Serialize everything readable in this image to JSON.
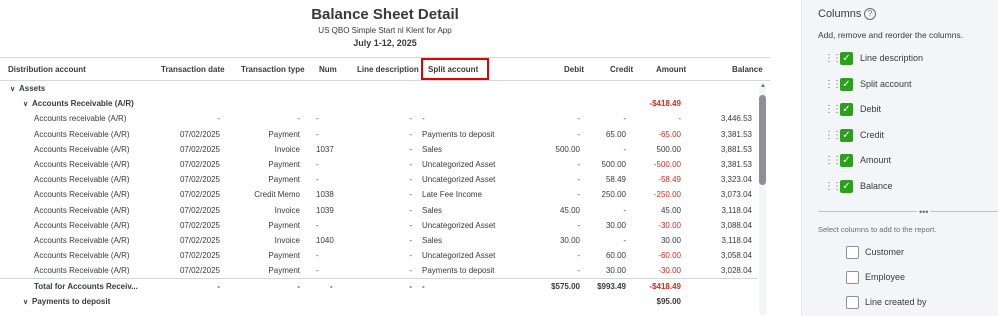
{
  "report": {
    "title": "Balance Sheet Detail",
    "company": "US QBO Simple Start nl Klent for App",
    "dates": "July 1-12, 2025",
    "columns": [
      "Distribution account",
      "Transaction date",
      "Transaction type",
      "Num",
      "Line description",
      "Split account",
      "Debit",
      "Credit",
      "Amount",
      "Balance"
    ],
    "section_assets": "Assets",
    "group_ar": "Accounts Receivable (A/R)",
    "group_ar_amount": "-$418.49",
    "rows": [
      {
        "acct": "Accounts receivable (A/R)",
        "date": "-",
        "type": "-",
        "num": "-",
        "desc": "-",
        "split": "-",
        "debit": "-",
        "credit": "-",
        "amount": "-",
        "balance": "3,446.53",
        "neg": false
      },
      {
        "acct": "Accounts Receivable (A/R)",
        "date": "07/02/2025",
        "type": "Payment",
        "num": "-",
        "desc": "-",
        "split": "Payments to deposit",
        "debit": "-",
        "credit": "65.00",
        "amount": "-65.00",
        "balance": "3,381.53",
        "neg": true
      },
      {
        "acct": "Accounts Receivable (A/R)",
        "date": "07/02/2025",
        "type": "Invoice",
        "num": "1037",
        "desc": "-",
        "split": "Sales",
        "debit": "500.00",
        "credit": "-",
        "amount": "500.00",
        "balance": "3,881.53",
        "neg": false
      },
      {
        "acct": "Accounts Receivable (A/R)",
        "date": "07/02/2025",
        "type": "Payment",
        "num": "-",
        "desc": "-",
        "split": "Uncategorized Asset",
        "debit": "-",
        "credit": "500.00",
        "amount": "-500.00",
        "balance": "3,381.53",
        "neg": true
      },
      {
        "acct": "Accounts Receivable (A/R)",
        "date": "07/02/2025",
        "type": "Payment",
        "num": "-",
        "desc": "-",
        "split": "Uncategorized Asset",
        "debit": "-",
        "credit": "58.49",
        "amount": "-58.49",
        "balance": "3,323.04",
        "neg": true
      },
      {
        "acct": "Accounts Receivable (A/R)",
        "date": "07/02/2025",
        "type": "Credit Memo",
        "num": "1038",
        "desc": "-",
        "split": "Late Fee Income",
        "debit": "-",
        "credit": "250.00",
        "amount": "-250.00",
        "balance": "3,073.04",
        "neg": true
      },
      {
        "acct": "Accounts Receivable (A/R)",
        "date": "07/02/2025",
        "type": "Invoice",
        "num": "1039",
        "desc": "-",
        "split": "Sales",
        "debit": "45.00",
        "credit": "-",
        "amount": "45.00",
        "balance": "3,118.04",
        "neg": false
      },
      {
        "acct": "Accounts Receivable (A/R)",
        "date": "07/02/2025",
        "type": "Payment",
        "num": "-",
        "desc": "-",
        "split": "Uncategorized Asset",
        "debit": "-",
        "credit": "30.00",
        "amount": "-30.00",
        "balance": "3,088.04",
        "neg": true
      },
      {
        "acct": "Accounts Receivable (A/R)",
        "date": "07/02/2025",
        "type": "Invoice",
        "num": "1040",
        "desc": "-",
        "split": "Sales",
        "debit": "30.00",
        "credit": "-",
        "amount": "30.00",
        "balance": "3,118.04",
        "neg": false
      },
      {
        "acct": "Accounts Receivable (A/R)",
        "date": "07/02/2025",
        "type": "Payment",
        "num": "-",
        "desc": "-",
        "split": "Uncategorized Asset",
        "debit": "-",
        "credit": "60.00",
        "amount": "-60.00",
        "balance": "3,058.04",
        "neg": true
      },
      {
        "acct": "Accounts Receivable (A/R)",
        "date": "07/02/2025",
        "type": "Payment",
        "num": "-",
        "desc": "-",
        "split": "Payments to deposit",
        "debit": "-",
        "credit": "30.00",
        "amount": "-30.00",
        "balance": "3,028.04",
        "neg": true
      }
    ],
    "total": {
      "acct": "Total for Accounts Receiv...",
      "date": "-",
      "type": "-",
      "num": "-",
      "desc": "-",
      "split": "-",
      "debit": "$575.00",
      "credit": "$993.49",
      "amount": "-$418.49",
      "balance": ""
    },
    "group_ptd": "Payments to deposit",
    "group_ptd_amount": "$95.00"
  },
  "panel": {
    "title": "Columns",
    "subtitle": "Add, remove and reorder the columns.",
    "selected": [
      "Line description",
      "Split account",
      "Debit",
      "Credit",
      "Amount",
      "Balance"
    ],
    "add_hint": "Select columns to add to the report.",
    "available": [
      "Customer",
      "Employee",
      "Line created by"
    ]
  },
  "colors": {
    "accent": "#2ca01c",
    "negative": "#d52b1e",
    "highlight": "#e00000"
  }
}
